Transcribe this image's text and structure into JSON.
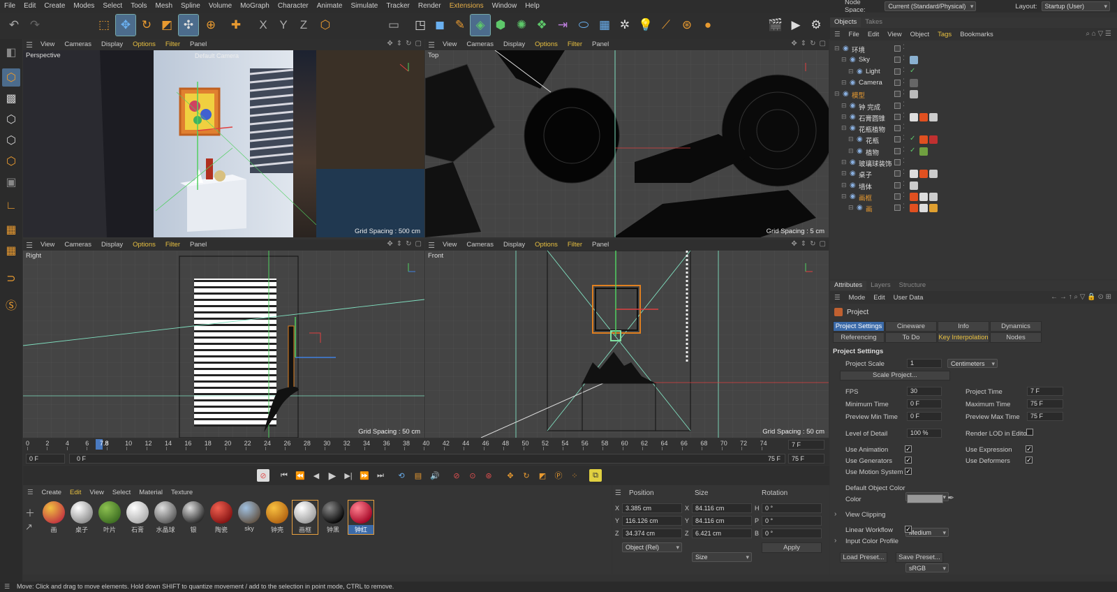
{
  "menu": [
    "File",
    "Edit",
    "Create",
    "Modes",
    "Select",
    "Tools",
    "Mesh",
    "Spline",
    "Volume",
    "MoGraph",
    "Character",
    "Animate",
    "Simulate",
    "Tracker",
    "Render",
    "Extensions",
    "Window",
    "Help"
  ],
  "node_space": {
    "label": "Node Space:",
    "value": "Current (Standard/Physical)"
  },
  "layout": {
    "label": "Layout:",
    "value": "Startup (User)"
  },
  "viewport_menu": [
    "View",
    "Cameras",
    "Display",
    "Options",
    "Filter",
    "Panel"
  ],
  "viewports": {
    "perspective": {
      "name": "Perspective",
      "camera": "Default Camera",
      "grid": "Grid Spacing : 500 cm"
    },
    "top": {
      "name": "Top",
      "grid": "Grid Spacing : 5 cm"
    },
    "right": {
      "name": "Right",
      "grid": "Grid Spacing : 50 cm"
    },
    "front": {
      "name": "Front",
      "grid": "Grid Spacing : 50 cm"
    }
  },
  "timeline": {
    "ticks": [
      "0",
      "2",
      "4",
      "6",
      "8",
      "10",
      "12",
      "14",
      "16",
      "18",
      "20",
      "22",
      "24",
      "26",
      "28",
      "30",
      "32",
      "34",
      "36",
      "38",
      "40",
      "42",
      "44",
      "46",
      "48",
      "50",
      "52",
      "54",
      "56",
      "58",
      "60",
      "62",
      "64",
      "66",
      "68",
      "70",
      "72",
      "74"
    ],
    "current_frame": "7.8",
    "start": "0 F",
    "start2": "0 F",
    "end": "75 F",
    "end2": "75 F",
    "frame_field": "7 F",
    "frame_field2": "75 F"
  },
  "material_menu": [
    "Create",
    "Edit",
    "View",
    "Select",
    "Material",
    "Texture"
  ],
  "materials": [
    {
      "label": "画",
      "color1": "#f0c040",
      "color2": "#c03040"
    },
    {
      "label": "桌子",
      "color1": "#ffffff",
      "color2": "#888888"
    },
    {
      "label": "叶片",
      "color1": "#8cc050",
      "color2": "#3a6a20"
    },
    {
      "label": "石膏",
      "color1": "#ffffff",
      "color2": "#aaaaaa"
    },
    {
      "label": "水晶球",
      "color1": "#e0e0e0",
      "color2": "#555555"
    },
    {
      "label": "银",
      "color1": "#dddddd",
      "color2": "#222222"
    },
    {
      "label": "陶瓷",
      "color1": "#f06050",
      "color2": "#801010"
    },
    {
      "label": "sky",
      "color1": "#a0c0e0",
      "color2": "#605040"
    },
    {
      "label": "钟壳",
      "color1": "#f8c040",
      "color2": "#b06010"
    },
    {
      "label": "画框",
      "color1": "#ffffff",
      "color2": "#999999"
    },
    {
      "label": "钟黑",
      "color1": "#888888",
      "color2": "#000000"
    },
    {
      "label": "钟红",
      "color1": "#ff8090",
      "color2": "#a00020"
    }
  ],
  "coords": {
    "headers": [
      "Position",
      "Size",
      "Rotation"
    ],
    "rows": [
      {
        "axis": "X",
        "pos": "3.385 cm",
        "saxis": "X",
        "size": "84.116 cm",
        "raxis": "H",
        "rot": "0 °"
      },
      {
        "axis": "Y",
        "pos": "116.126 cm",
        "saxis": "Y",
        "size": "84.116 cm",
        "raxis": "P",
        "rot": "0 °"
      },
      {
        "axis": "Z",
        "pos": "34.374 cm",
        "saxis": "Z",
        "size": "6.421 cm",
        "raxis": "B",
        "rot": "0 °"
      }
    ],
    "mode": "Object (Rel)",
    "size_mode": "Size",
    "apply": "Apply"
  },
  "objects_panel": {
    "tabs": [
      "Objects",
      "Takes"
    ],
    "menu": [
      "File",
      "Edit",
      "View",
      "Object",
      "Tags",
      "Bookmarks"
    ],
    "items": [
      {
        "name": "环境",
        "indent": 0,
        "orange": false,
        "tags": []
      },
      {
        "name": "Sky",
        "indent": 1,
        "orange": false,
        "tags": [
          "#8ab0d0"
        ]
      },
      {
        "name": "Light",
        "indent": 2,
        "orange": false,
        "tags": [
          "check"
        ]
      },
      {
        "name": "Camera",
        "indent": 1,
        "orange": false,
        "tags": [
          "#666"
        ]
      },
      {
        "name": "模型",
        "indent": 0,
        "orange": true,
        "tags": [
          "#bbb"
        ]
      },
      {
        "name": "钟 完成",
        "indent": 1,
        "orange": false,
        "tags": []
      },
      {
        "name": "石膏圆锥",
        "indent": 1,
        "orange": false,
        "tags": [
          "#ddd",
          "#e05020",
          "#ccc"
        ]
      },
      {
        "name": "花瓶植物",
        "indent": 1,
        "orange": false,
        "tags": []
      },
      {
        "name": "花瓶",
        "indent": 2,
        "orange": false,
        "tags": [
          "check",
          "#e05020",
          "#c03030"
        ]
      },
      {
        "name": "植物",
        "indent": 2,
        "orange": false,
        "tags": [
          "check",
          "#70a040"
        ]
      },
      {
        "name": "玻璃球装饰",
        "indent": 1,
        "orange": false,
        "tags": []
      },
      {
        "name": "桌子",
        "indent": 1,
        "orange": false,
        "tags": [
          "#ddd",
          "#e05020",
          "#ccc"
        ]
      },
      {
        "name": "墙体",
        "indent": 1,
        "orange": false,
        "tags": [
          "#ccc"
        ]
      },
      {
        "name": "画框",
        "indent": 1,
        "orange": true,
        "tags": [
          "#e05020",
          "#ddd",
          "#ccc"
        ]
      },
      {
        "name": "画",
        "indent": 2,
        "orange": true,
        "tags": [
          "#e05020",
          "#ddd",
          "#e0a030"
        ]
      }
    ]
  },
  "attributes": {
    "tabs": [
      "Attributes",
      "Layers",
      "Structure"
    ],
    "menu": [
      "Mode",
      "Edit",
      "User Data"
    ],
    "title": "Project",
    "btn_row1": [
      "Project Settings",
      "Cineware",
      "Info",
      "Dynamics"
    ],
    "btn_row2": [
      "Referencing",
      "To Do",
      "Key Interpolation",
      "Nodes"
    ],
    "section": "Project Settings",
    "project_scale_label": "Project Scale",
    "project_scale": "1",
    "scale_unit": "Centimeters",
    "scale_project": "Scale Project...",
    "fps_label": "FPS",
    "fps": "30",
    "project_time_label": "Project Time",
    "project_time": "7 F",
    "min_time_label": "Minimum Time",
    "min_time": "0 F",
    "max_time_label": "Maximum Time",
    "max_time": "75 F",
    "prev_min_label": "Preview Min Time",
    "prev_min": "0 F",
    "prev_max_label": "Preview Max Time",
    "prev_max": "75 F",
    "lod_label": "Level of Detail",
    "lod": "100 %",
    "render_lod_label": "Render LOD in Editor",
    "use_anim": "Use Animation",
    "use_expr": "Use Expression",
    "use_gen": "Use Generators",
    "use_def": "Use Deformers",
    "use_motion": "Use Motion System",
    "default_color_label": "Default Object Color",
    "default_color": "60% Gray",
    "color_label": "Color",
    "view_clip_label": "View Clipping",
    "view_clip": "Medium",
    "linear_label": "Linear Workflow",
    "input_profile_label": "Input Color Profile",
    "input_profile": "sRGB",
    "load_preset": "Load Preset...",
    "save_preset": "Save Preset..."
  },
  "status": "Move: Click and drag to move elements. Hold down SHIFT to quantize movement / add to the selection in point mode, CTRL to remove."
}
